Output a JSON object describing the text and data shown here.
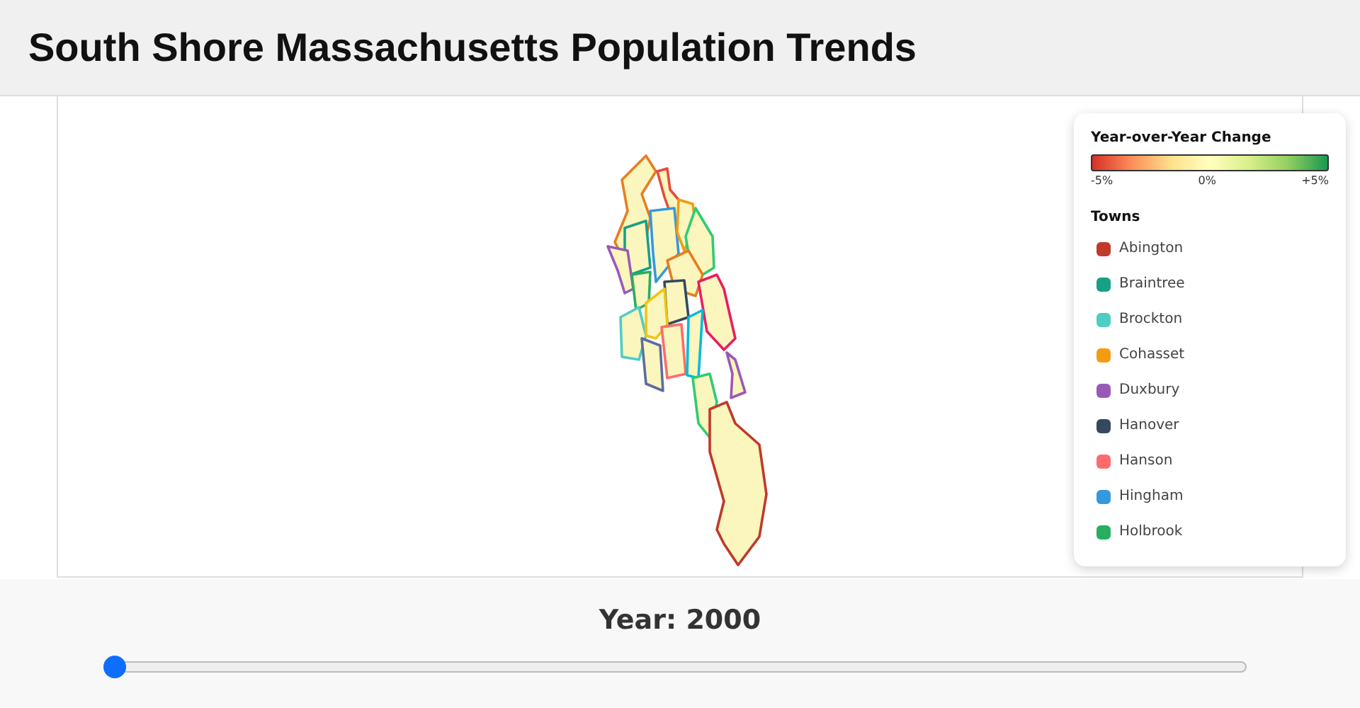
{
  "title": "South Shore Massachusetts Population Trends",
  "legend": {
    "title": "Year-over-Year Change",
    "scale_labels": [
      "-5%",
      "0%",
      "+5%"
    ],
    "towns_title": "Towns",
    "towns": [
      {
        "name": "Abington",
        "color": "#c0392b"
      },
      {
        "name": "Braintree",
        "color": "#16a085"
      },
      {
        "name": "Brockton",
        "color": "#4ecdc4"
      },
      {
        "name": "Cohasset",
        "color": "#f39c12"
      },
      {
        "name": "Duxbury",
        "color": "#9b59b6"
      },
      {
        "name": "Hanover",
        "color": "#34495e"
      },
      {
        "name": "Hanson",
        "color": "#ff6b6b"
      },
      {
        "name": "Hingham",
        "color": "#3498db"
      },
      {
        "name": "Holbrook",
        "color": "#27ae60"
      }
    ]
  },
  "year_label": "Year: 2000",
  "slider": {
    "level": 0
  }
}
